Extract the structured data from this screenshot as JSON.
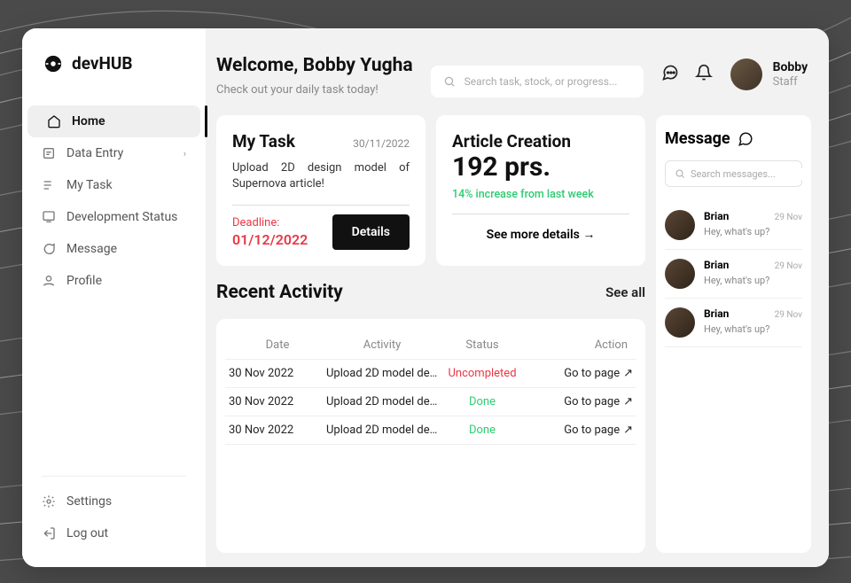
{
  "brand": {
    "name": "devHUB"
  },
  "header": {
    "welcome_title": "Welcome, Bobby Yugha",
    "welcome_sub": "Check out your daily task today!",
    "search_placeholder": "Search task, stock, or progress..."
  },
  "user": {
    "name": "Bobby",
    "role": "Staff"
  },
  "sidebar": {
    "items": [
      {
        "label": "Home",
        "active": true
      },
      {
        "label": "Data Entry",
        "chev": true
      },
      {
        "label": "My Task"
      },
      {
        "label": "Development Status"
      },
      {
        "label": "Message"
      },
      {
        "label": "Profile"
      }
    ],
    "footer": [
      {
        "label": "Settings"
      },
      {
        "label": "Log out"
      }
    ]
  },
  "mytask": {
    "title": "My Task",
    "date": "30/11/2022",
    "desc": "Upload 2D design model of Supernova article!",
    "deadline_label": "Deadline:",
    "deadline_value": "01/12/2022",
    "details_btn": "Details"
  },
  "article": {
    "title": "Article Creation",
    "count": "192 prs.",
    "increase": "14% increase from last week",
    "see_more": "See more details →"
  },
  "recent": {
    "title": "Recent Activity",
    "see_all": "See all",
    "columns": {
      "date": "Date",
      "activity": "Activity",
      "status": "Status",
      "action": "Action"
    },
    "rows": [
      {
        "date": "30 Nov 2022",
        "activity": "Upload 2D model des...",
        "status": "Uncompleted",
        "status_kind": "uncompleted",
        "action": "Go to page"
      },
      {
        "date": "30 Nov 2022",
        "activity": "Upload 2D model des...",
        "status": "Done",
        "status_kind": "done",
        "action": "Go to page"
      },
      {
        "date": "30 Nov 2022",
        "activity": "Upload 2D model des...",
        "status": "Done",
        "status_kind": "done",
        "action": "Go to page"
      }
    ]
  },
  "messages": {
    "title": "Message",
    "search_placeholder": "Search messages...",
    "items": [
      {
        "name": "Brian",
        "time": "29 Nov",
        "text": "Hey, what's up?"
      },
      {
        "name": "Brian",
        "time": "29 Nov",
        "text": "Hey, what's up?"
      },
      {
        "name": "Brian",
        "time": "29 Nov",
        "text": "Hey, what's up?"
      }
    ]
  }
}
